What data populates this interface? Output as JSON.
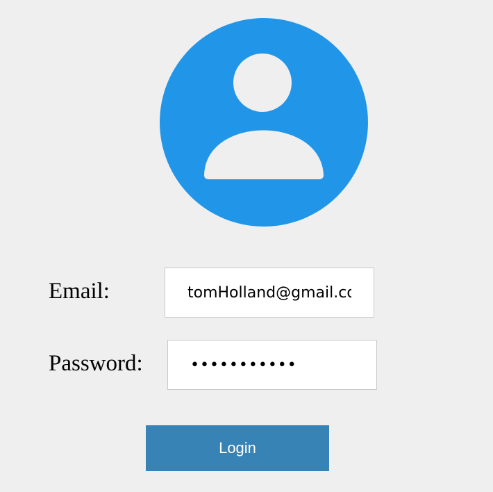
{
  "avatar": {
    "icon": "user-avatar-icon",
    "circle_color": "#2196e9",
    "figure_color": "#efefef"
  },
  "form": {
    "email_label": "Email:",
    "email_value": "tomHolland@gmail.com",
    "password_label": "Password:",
    "password_value": "•••••••••••",
    "login_label": "Login"
  },
  "colors": {
    "background": "#efefef",
    "login_button": "#3783b5",
    "login_text": "#ffffff",
    "field_border": "#c8c8c8"
  }
}
